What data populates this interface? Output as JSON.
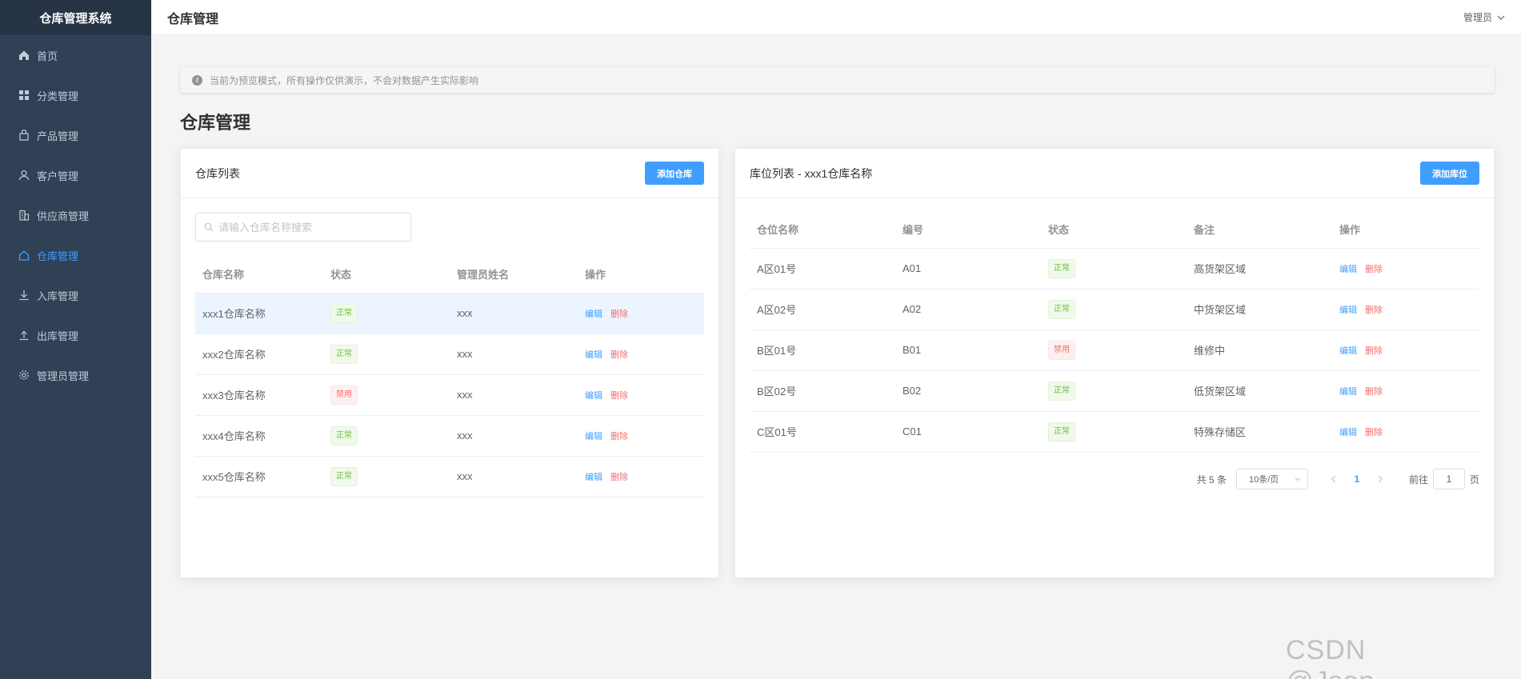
{
  "app": {
    "title": "仓库管理系统"
  },
  "sidebar": {
    "items": [
      {
        "label": "首页",
        "icon": "home-icon"
      },
      {
        "label": "分类管理",
        "icon": "grid-icon"
      },
      {
        "label": "产品管理",
        "icon": "bag-icon"
      },
      {
        "label": "客户管理",
        "icon": "user-icon"
      },
      {
        "label": "供应商管理",
        "icon": "building-icon"
      },
      {
        "label": "仓库管理",
        "icon": "house-icon",
        "active": true
      },
      {
        "label": "入库管理",
        "icon": "download-icon"
      },
      {
        "label": "出库管理",
        "icon": "upload-icon"
      },
      {
        "label": "管理员管理",
        "icon": "gear-icon"
      }
    ]
  },
  "header": {
    "title": "仓库管理",
    "user": "管理员"
  },
  "notice": {
    "text": "当前为预览模式，所有操作仅供演示，不会对数据产生实际影响"
  },
  "page": {
    "title": "仓库管理"
  },
  "warehouse": {
    "title": "仓库列表",
    "add_label": "添加仓库",
    "search_placeholder": "请输入仓库名称搜索",
    "columns": [
      "仓库名称",
      "状态",
      "管理员姓名",
      "操作"
    ],
    "rows": [
      {
        "name": "xxx1仓库名称",
        "status": "正常",
        "manager": "xxx"
      },
      {
        "name": "xxx2仓库名称",
        "status": "正常",
        "manager": "xxx"
      },
      {
        "name": "xxx3仓库名称",
        "status": "禁用",
        "manager": "xxx"
      },
      {
        "name": "xxx4仓库名称",
        "status": "正常",
        "manager": "xxx"
      },
      {
        "name": "xxx5仓库名称",
        "status": "正常",
        "manager": "xxx"
      }
    ],
    "edit_label": "编辑",
    "delete_label": "删除"
  },
  "location": {
    "title": "库位列表 - xxx1仓库名称",
    "add_label": "添加库位",
    "columns": [
      "仓位名称",
      "编号",
      "状态",
      "备注",
      "操作"
    ],
    "rows": [
      {
        "name": "A区01号",
        "code": "A01",
        "status": "正常",
        "note": "高货架区域"
      },
      {
        "name": "A区02号",
        "code": "A02",
        "status": "正常",
        "note": "中货架区域"
      },
      {
        "name": "B区01号",
        "code": "B01",
        "status": "禁用",
        "note": "维修中"
      },
      {
        "name": "B区02号",
        "code": "B02",
        "status": "正常",
        "note": "低货架区域"
      },
      {
        "name": "C区01号",
        "code": "C01",
        "status": "正常",
        "note": "特殊存储区"
      }
    ],
    "edit_label": "编辑",
    "delete_label": "删除",
    "pagination": {
      "total": "共 5 条",
      "page_size": "10条/页",
      "current": "1",
      "goto_prefix": "前往",
      "goto_value": "1",
      "goto_suffix": "页"
    }
  },
  "watermark": "CSDN @Json_____",
  "colors": {
    "primary": "#409eff",
    "sidebar": "#304156",
    "success": "#67c23a",
    "danger": "#f56c6c"
  }
}
